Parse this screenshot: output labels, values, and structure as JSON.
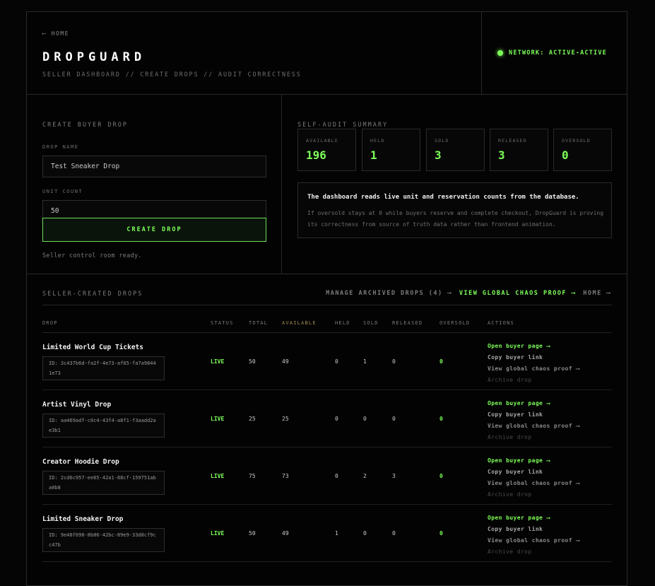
{
  "header": {
    "home_link": "⟵ HOME",
    "title": "DROPGUARD",
    "tagline": "SELLER DASHBOARD // CREATE DROPS // AUDIT CORRECTNESS",
    "network_status": "NETWORK: ACTIVE-ACTIVE"
  },
  "create_panel": {
    "title": "CREATE BUYER DROP",
    "drop_name_label": "DROP NAME",
    "drop_name_value": "Test Sneaker Drop",
    "unit_count_label": "UNIT COUNT",
    "unit_count_value": "50",
    "create_button": "CREATE DROP",
    "status_message": "Seller control room ready."
  },
  "audit_panel": {
    "title": "SELF-AUDIT SUMMARY",
    "stats": [
      {
        "label": "AVAILABLE",
        "value": "196"
      },
      {
        "label": "HELD",
        "value": "1"
      },
      {
        "label": "SOLD",
        "value": "3"
      },
      {
        "label": "RELEASED",
        "value": "3"
      },
      {
        "label": "OVERSOLD",
        "value": "0"
      }
    ],
    "note_title": "The dashboard reads live unit and reservation counts from the database.",
    "note_body": "If oversold stays at 0 while buyers reserve and complete checkout, DropGuard is proving its correctness from source of truth data rather than frontend animation."
  },
  "drops": {
    "title": "SELLER-CREATED DROPS",
    "links": {
      "archived": "MANAGE ARCHIVED DROPS (4) ⟶",
      "chaos": "VIEW GLOBAL CHAOS PROOF ⟶",
      "home": "HOME ⟶"
    },
    "columns": {
      "drop": "DROP",
      "status": "STATUS",
      "total": "TOTAL",
      "available": "AVAILABLE",
      "held": "HELD",
      "sold": "SOLD",
      "released": "RELEASED",
      "oversold": "OVERSOLD",
      "actions": "ACTIONS"
    },
    "actions": {
      "open": "Open buyer page ⟶",
      "copy": "Copy buyer link",
      "proof": "View global chaos proof ⟶",
      "archive": "Archive drop"
    },
    "rows": [
      {
        "name": "Limited World Cup Tickets",
        "id": "ID: 3c437b6d-fa2f-4e73-af65-fa7a98441e73",
        "status": "LIVE",
        "total": "50",
        "available": "49",
        "held": "0",
        "sold": "1",
        "released": "0",
        "oversold": "0"
      },
      {
        "name": "Artist Vinyl Drop",
        "id": "ID: aa469adf-c0c4-43f4-a8f1-f3aadd2ae3b1",
        "status": "LIVE",
        "total": "25",
        "available": "25",
        "held": "0",
        "sold": "0",
        "released": "0",
        "oversold": "0"
      },
      {
        "name": "Creator Hoodie Drop",
        "id": "ID: 2cd6c957-ee65-42a1-88cf-159751aba0b8",
        "status": "LIVE",
        "total": "75",
        "available": "73",
        "held": "0",
        "sold": "2",
        "released": "3",
        "oversold": "0"
      },
      {
        "name": "Limited Sneaker Drop",
        "id": "ID: 9e48f090-8b06-42bc-89e9-33d8cf9cc47b",
        "status": "LIVE",
        "total": "50",
        "available": "49",
        "held": "1",
        "sold": "0",
        "released": "0",
        "oversold": "0"
      }
    ]
  }
}
